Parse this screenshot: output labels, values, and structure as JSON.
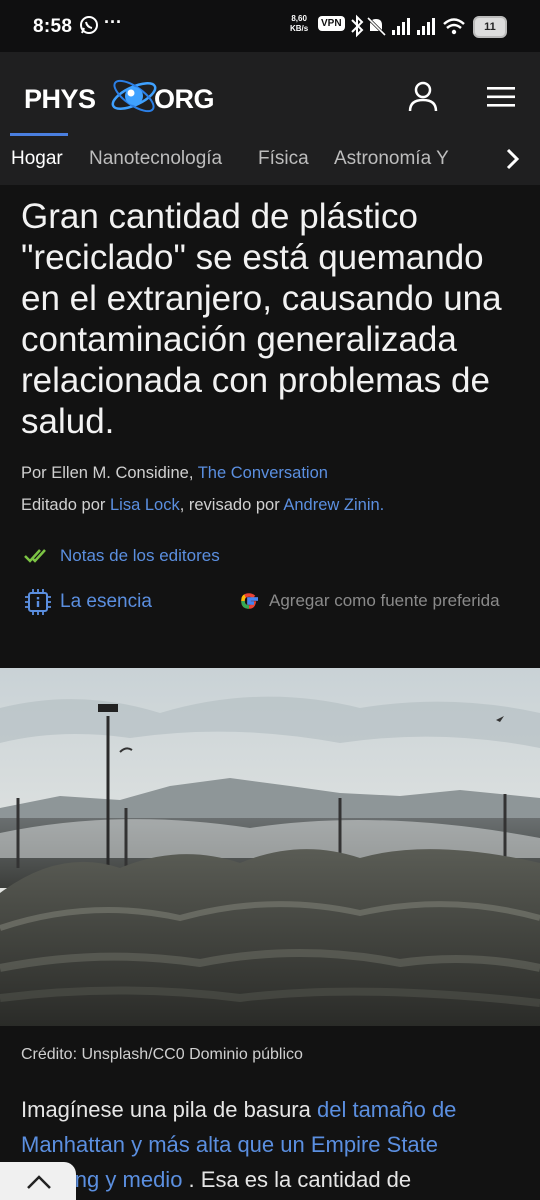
{
  "status_bar": {
    "time": "8:58",
    "net_speed_value": "8,60",
    "net_speed_unit": "KB/s",
    "vpn": "VPN",
    "battery": "11",
    "icons": [
      "whatsapp-icon",
      "more-dots",
      "bluetooth-icon",
      "mute-icon",
      "signal-icon",
      "signal-icon",
      "wifi-icon",
      "battery-icon"
    ]
  },
  "header": {
    "logo_left": "PHYS",
    "logo_right": "ORG",
    "icons": [
      "user-icon",
      "hamburger-menu-icon"
    ]
  },
  "nav": {
    "items": [
      "Hogar",
      "Nanotecnología",
      "Física",
      "Astronomía Y"
    ],
    "active_index": 0
  },
  "article": {
    "title": "Gran cantidad de plástico \"reciclado\" se está quemando en el extranjero, causando una contaminación generalizada relacionada con problemas de salud.",
    "byline_prefix": "Por Ellen M. Considine,",
    "byline_source": "The Conversation",
    "edited_prefix": "Editado por",
    "editor": "Lisa Lock",
    "reviewed_prefix": ", revisado por",
    "reviewer": "Andrew Zinin.",
    "notes_label": "Notas de los editores",
    "gist_label": "La esencia",
    "google_source_label": "Agregar como fuente preferida",
    "image_credit": "Crédito: Unsplash/CC0 Dominio público",
    "body_start": "Imagínese una pila de basura ",
    "body_link": "del tamaño de Manhattan y más alta que un Empire State Building y medio",
    "body_end": " . Esa es la cantidad de"
  },
  "colors": {
    "link": "#5b8fe0",
    "header_bg": "#1f1f20",
    "page_bg": "#121212",
    "accent_check": "#7cc444"
  }
}
